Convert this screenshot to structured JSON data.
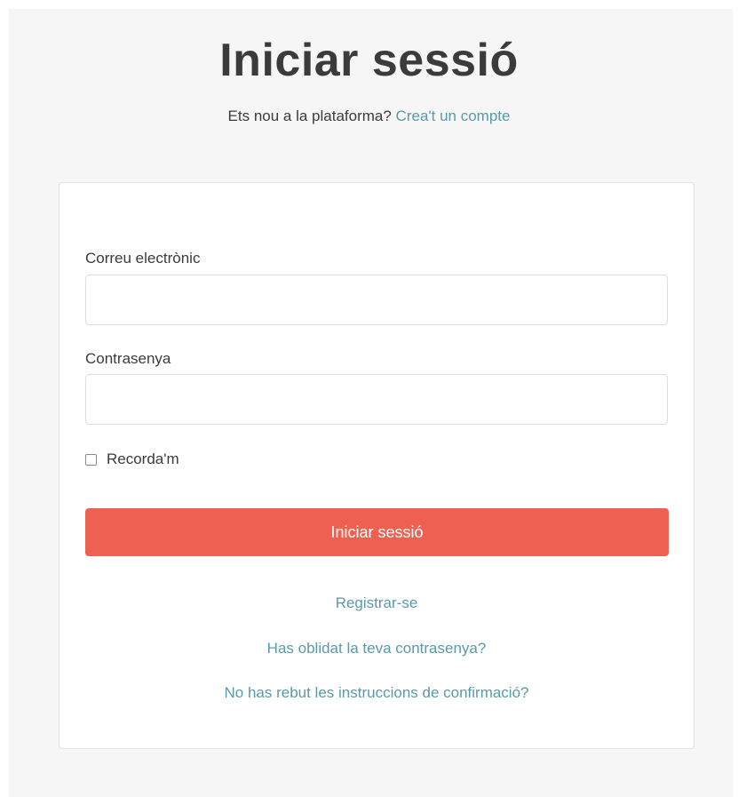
{
  "page": {
    "title": "Iniciar sessió",
    "subtitle_text": "Ets nou a la plataforma?",
    "create_account_link": "Crea't un compte"
  },
  "form": {
    "email_label": "Correu electrònic",
    "email_value": "",
    "password_label": "Contrasenya",
    "password_value": "",
    "remember_label": "Recorda'm",
    "remember_checked": false,
    "submit_label": "Iniciar sessió"
  },
  "links": {
    "register": "Registrar-se",
    "forgot_password": "Has oblidat la teva contrasenya?",
    "no_confirmation": "No has rebut les instruccions de confirmació?"
  },
  "colors": {
    "accent_link": "#5a9aa8",
    "submit_button": "#ee6150",
    "background": "#f6f6f6"
  }
}
